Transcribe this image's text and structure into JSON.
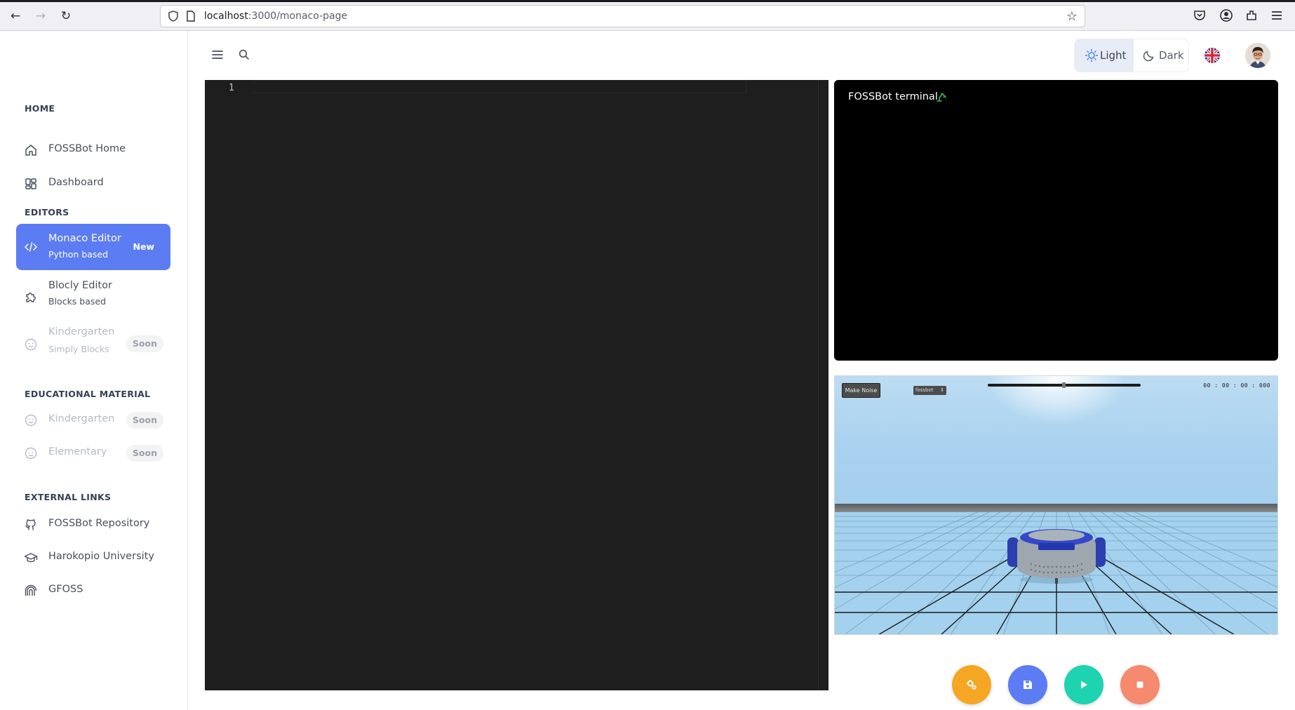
{
  "browser": {
    "url_host": "localhost",
    "url_path": ":3000/monaco-page"
  },
  "sidebar": {
    "sections": [
      {
        "title": "HOME"
      },
      {
        "title": "EDITORS"
      },
      {
        "title": "EDUCATIONAL MATERIAL"
      },
      {
        "title": "EXTERNAL LINKS"
      }
    ],
    "home_items": [
      {
        "label": "FOSSBot Home",
        "icon": "home-icon"
      },
      {
        "label": "Dashboard",
        "icon": "dashboard-icon"
      }
    ],
    "editor_items": [
      {
        "label": "Monaco Editor",
        "sub": "Python based",
        "badge": "New",
        "icon": "code-icon",
        "active": true
      },
      {
        "label": "Blocly Editor",
        "sub": "Blocks based",
        "icon": "puzzle-icon"
      },
      {
        "label": "Kindergarten",
        "sub": "Simply Blocks",
        "badge": "Soon",
        "icon": "smiley-icon",
        "disabled": true
      }
    ],
    "edu_items": [
      {
        "label": "Kindergarten",
        "badge": "Soon",
        "icon": "smiley-icon",
        "disabled": true
      },
      {
        "label": "Elementary",
        "badge": "Soon",
        "icon": "mood-icon",
        "disabled": true
      }
    ],
    "external_items": [
      {
        "label": "FOSSBot Repository",
        "icon": "github-icon"
      },
      {
        "label": "Harokopio University",
        "icon": "school-icon"
      },
      {
        "label": "GFOSS",
        "icon": "gfoss-icon"
      }
    ]
  },
  "header": {
    "theme_light": "Light",
    "theme_dark": "Dark"
  },
  "editor": {
    "line_numbers": [
      "1"
    ]
  },
  "terminal": {
    "title": "FOSSBot terminal"
  },
  "simulator": {
    "noise_button": "Make Noise",
    "robot_select": "fossbot",
    "timer": "00 : 00 : 00 : 000"
  },
  "colors": {
    "accent": "#5b7cf2",
    "settings_button": "#f5a623",
    "save_button": "#5b7cf2",
    "run_button": "#1dd3b0",
    "stop_button": "#f58a6e"
  }
}
